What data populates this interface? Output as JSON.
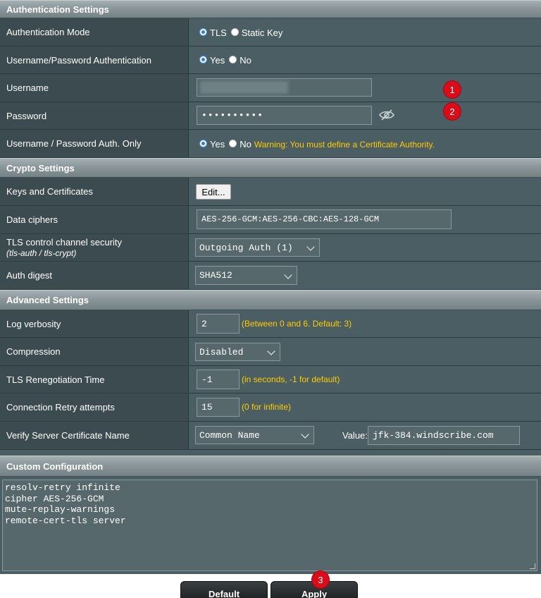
{
  "auth_section": {
    "title": "Authentication Settings",
    "auth_mode": {
      "label": "Authentication Mode",
      "options": [
        "TLS",
        "Static Key"
      ],
      "selected": "TLS"
    },
    "userpass_auth": {
      "label": "Username/Password Authentication",
      "options": [
        "Yes",
        "No"
      ],
      "selected": "Yes"
    },
    "username": {
      "label": "Username",
      "value": ""
    },
    "password": {
      "label": "Password",
      "value": "••••••••••"
    },
    "auth_only": {
      "label": "Username / Password Auth. Only",
      "options": [
        "Yes",
        "No"
      ],
      "selected": "Yes",
      "warning": "Warning: You must define a Certificate Authority."
    }
  },
  "crypto_section": {
    "title": "Crypto Settings",
    "keys_certs": {
      "label": "Keys and Certificates",
      "button": "Edit..."
    },
    "data_ciphers": {
      "label": "Data ciphers",
      "value": "AES-256-GCM:AES-256-CBC:AES-128-GCM"
    },
    "tls_control": {
      "label": "TLS control channel security",
      "sublabel": "(tls-auth / tls-crypt)",
      "value": "Outgoing Auth (1)"
    },
    "auth_digest": {
      "label": "Auth digest",
      "value": "SHA512"
    }
  },
  "advanced_section": {
    "title": "Advanced Settings",
    "log_verbosity": {
      "label": "Log verbosity",
      "value": "2",
      "hint": "(Between 0 and 6. Default: 3)"
    },
    "compression": {
      "label": "Compression",
      "value": "Disabled"
    },
    "tls_reneg": {
      "label": "TLS Renegotiation Time",
      "value": "-1",
      "hint": "(in seconds, -1 for default)"
    },
    "retry": {
      "label": "Connection Retry attempts",
      "value": "15",
      "hint": "(0 for infinite)"
    },
    "verify_cert": {
      "label": "Verify Server Certificate Name",
      "value": "Common Name",
      "value_label": "Value:",
      "value_text": "jfk-384.windscribe.com"
    }
  },
  "custom_section": {
    "title": "Custom Configuration",
    "lines": [
      "resolv-retry infinite",
      "cipher AES-256-GCM",
      "mute-replay-warnings",
      "remote-cert-tls server"
    ]
  },
  "buttons": {
    "default": "Default",
    "apply": "Apply"
  },
  "badges": {
    "one": "1",
    "two": "2",
    "three": "3"
  },
  "colors": {
    "accent_warning": "#ffcc00",
    "badge_red": "#d90c1a",
    "panel_bg": "#4b5e63"
  },
  "icons": {
    "password_toggle": "eye-slash-icon"
  }
}
